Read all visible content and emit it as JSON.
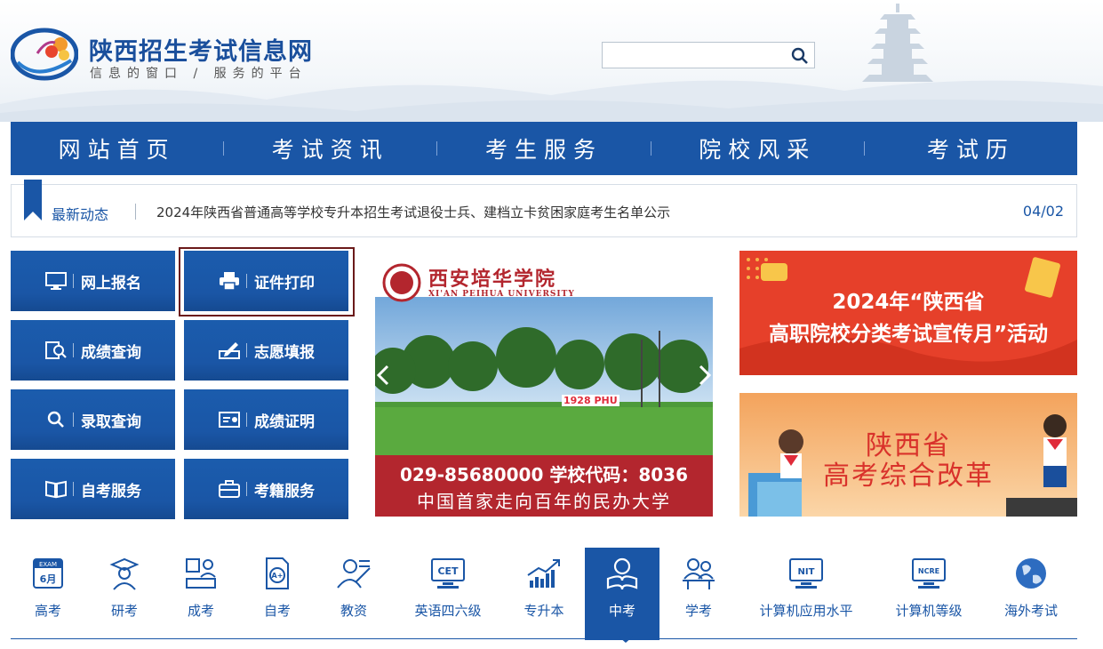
{
  "header": {
    "title": "陕西招生考试信息网",
    "subtitle": "信息的窗口 / 服务的平台",
    "search": {
      "value": "",
      "placeholder": ""
    }
  },
  "nav": {
    "items": [
      {
        "label": "网站首页"
      },
      {
        "label": "考试资讯"
      },
      {
        "label": "考生服务"
      },
      {
        "label": "院校风采"
      },
      {
        "label": "考试历"
      }
    ]
  },
  "news": {
    "label": "最新动态",
    "headline": "2024年陕西省普通高等学校专升本招生考试退役士兵、建档立卡贫困家庭考生名单公示",
    "date": "04/02"
  },
  "services": [
    {
      "label": "网上报名",
      "icon": "monitor-icon"
    },
    {
      "label": "证件打印",
      "icon": "printer-icon"
    },
    {
      "label": "成绩查询",
      "icon": "score-search-icon"
    },
    {
      "label": "志愿填报",
      "icon": "pen-form-icon"
    },
    {
      "label": "录取查询",
      "icon": "search-icon"
    },
    {
      "label": "成绩证明",
      "icon": "certificate-icon"
    },
    {
      "label": "自考服务",
      "icon": "book-icon"
    },
    {
      "label": "考籍服务",
      "icon": "briefcase-icon"
    }
  ],
  "banners": {
    "university": {
      "name_cn": "西安培华学院",
      "name_en": "XI'AN PEIHUA UNIVERSITY",
      "sign": "1928 PHU",
      "phone_line": "029-85680000  学校代码：8036",
      "slogan": "中国首家走向百年的民办大学"
    },
    "promo": {
      "line1": "2024年“陕西省",
      "line2": "高职院校分类考试宣传月”活动"
    },
    "reform": {
      "line1": "陕西省",
      "line2": "高考综合改革"
    }
  },
  "categories": [
    {
      "label": "高考",
      "icon": "exam-calendar-icon",
      "badge": "EXAM",
      "badge2": "6月"
    },
    {
      "label": "研考",
      "icon": "graduate-icon"
    },
    {
      "label": "成考",
      "icon": "adult-exam-icon"
    },
    {
      "label": "自考",
      "icon": "grade-document-icon",
      "badge": "A+"
    },
    {
      "label": "教资",
      "icon": "teacher-icon"
    },
    {
      "label": "英语四六级",
      "icon": "cet-monitor-icon",
      "badge": "CET"
    },
    {
      "label": "专升本",
      "icon": "growth-chart-icon"
    },
    {
      "label": "中考",
      "icon": "student-reading-icon",
      "active": true
    },
    {
      "label": "学考",
      "icon": "students-desk-icon"
    },
    {
      "label": "计算机应用水平",
      "icon": "nit-monitor-icon",
      "badge": "NIT"
    },
    {
      "label": "计算机等级",
      "icon": "ncre-monitor-icon",
      "badge": "NCRE"
    },
    {
      "label": "海外考试",
      "icon": "globe-icon"
    }
  ],
  "colors": {
    "primary": "#1a56a6",
    "accent": "#e8452e",
    "selected_border": "#6b1a1a"
  }
}
